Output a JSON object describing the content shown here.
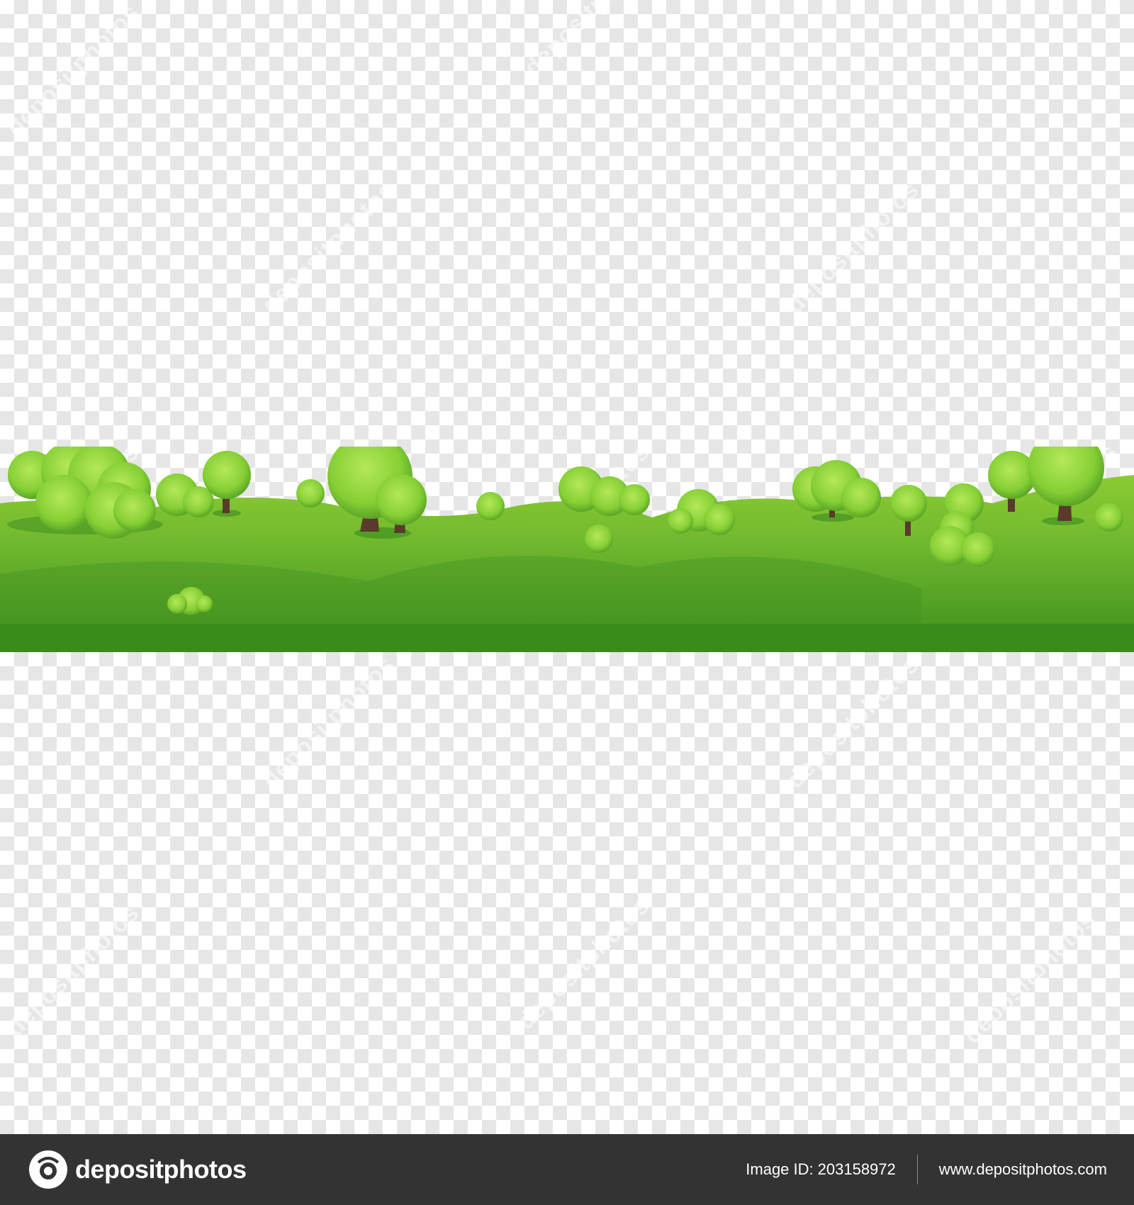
{
  "watermark": {
    "text": "depositphotos"
  },
  "footer": {
    "brand": "depositphotos",
    "image_id_label": "Image ID:",
    "image_id": "203158972",
    "website": "www.depositphotos.com"
  },
  "colors": {
    "grass_light": "#8cc63f",
    "grass_dark": "#3c8a1e",
    "foliage": "#8cd23a",
    "trunk": "#5a3a2a",
    "footer_bg": "#333333"
  }
}
